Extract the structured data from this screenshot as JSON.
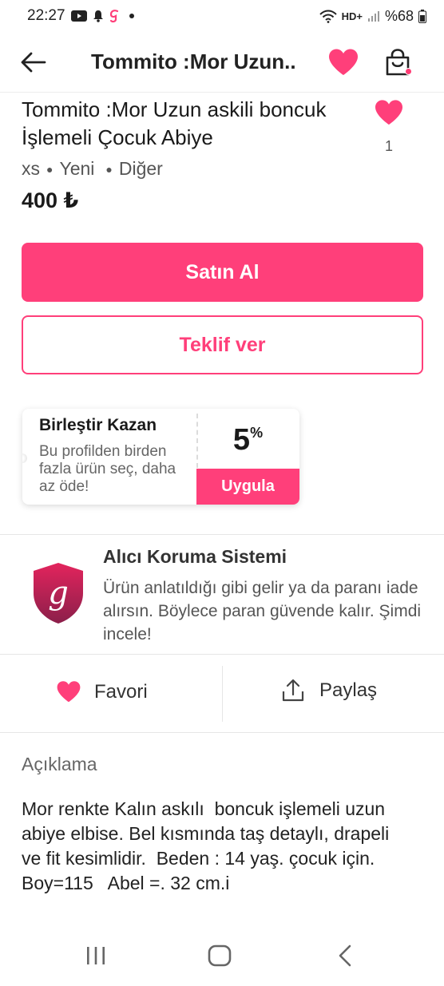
{
  "status_bar": {
    "time": "22:27",
    "network": "HD+",
    "battery": "%68"
  },
  "app_bar": {
    "title": "Tommito :Mor Uzun.."
  },
  "product": {
    "title": "Tommito :Mor Uzun askili boncuk İşlemeli Çocuk  Abiye",
    "like_count": "1",
    "size": "xs",
    "condition": "Yeni",
    "category": "Diğer",
    "price": "400 ₺"
  },
  "actions": {
    "buy_label": "Satın Al",
    "offer_label": "Teklif ver"
  },
  "bundle": {
    "title": "Birleştir Kazan",
    "description": "Bu profilden birden fazla ürün seç, daha az öde!",
    "percent": "5",
    "percent_sign": "%",
    "apply_label": "Uygula"
  },
  "protection": {
    "title": "Alıcı Koruma Sistemi",
    "description": "Ürün anlatıldığı gibi gelir ya da paranı iade alırsın. Böylece paran güvende kalır. Şimdi incele!",
    "logo_letter": "g"
  },
  "social": {
    "favorite_label": "Favori",
    "share_label": "Paylaş"
  },
  "description": {
    "heading": "Açıklama",
    "body": "Mor renkte Kalın askılı  boncuk işlemeli uzun abiye elbise. Bel kısmında taş detaylı, drapeli ve fit kesimlidir.  Beden : 14 yaş. çocuk için.  Boy=115   Abel =. 32 cm.i"
  },
  "colors": {
    "accent": "#ff3f7a",
    "shield_top": "#e3245d",
    "shield_bottom": "#8b1f4a"
  },
  "icons": {
    "back": "arrow-left-icon",
    "favorite": "heart-icon",
    "cart": "shopping-bag-icon",
    "share": "share-icon",
    "shield": "shield-logo-icon",
    "nav_recents": "recents-icon",
    "nav_home": "home-icon",
    "nav_back": "nav-back-icon"
  }
}
